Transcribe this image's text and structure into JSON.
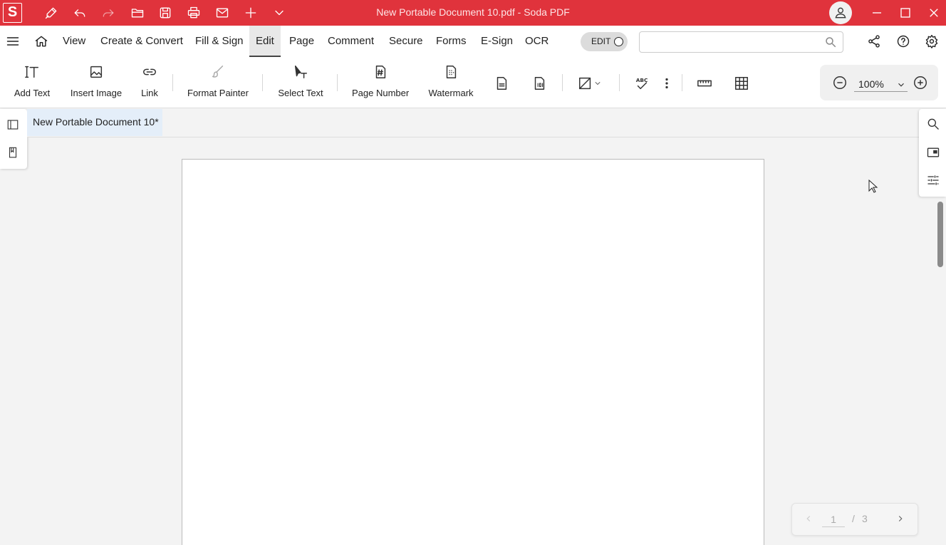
{
  "app": {
    "window_title": "New Portable Document 10.pdf   -   Soda PDF",
    "logo_letter": "S"
  },
  "menu": {
    "items": [
      "View",
      "Create & Convert",
      "Fill & Sign",
      "Edit",
      "Page",
      "Comment",
      "Secure",
      "Forms",
      "E-Sign",
      "OCR"
    ],
    "active": "Edit",
    "edit_toggle_label": "EDIT",
    "search_placeholder": ""
  },
  "ribbon": {
    "add_text": "Add Text",
    "insert_image": "Insert Image",
    "link": "Link",
    "format_painter": "Format Painter",
    "select_text": "Select Text",
    "page_number": "Page Number",
    "watermark": "Watermark",
    "zoom": "100%"
  },
  "tabs": {
    "document_tab": "New Portable Document 10*"
  },
  "pagination": {
    "current": "1",
    "separator": "/",
    "total": "3"
  },
  "colors": {
    "brand": "#e0333c",
    "active_tab": "#e4eef9"
  }
}
